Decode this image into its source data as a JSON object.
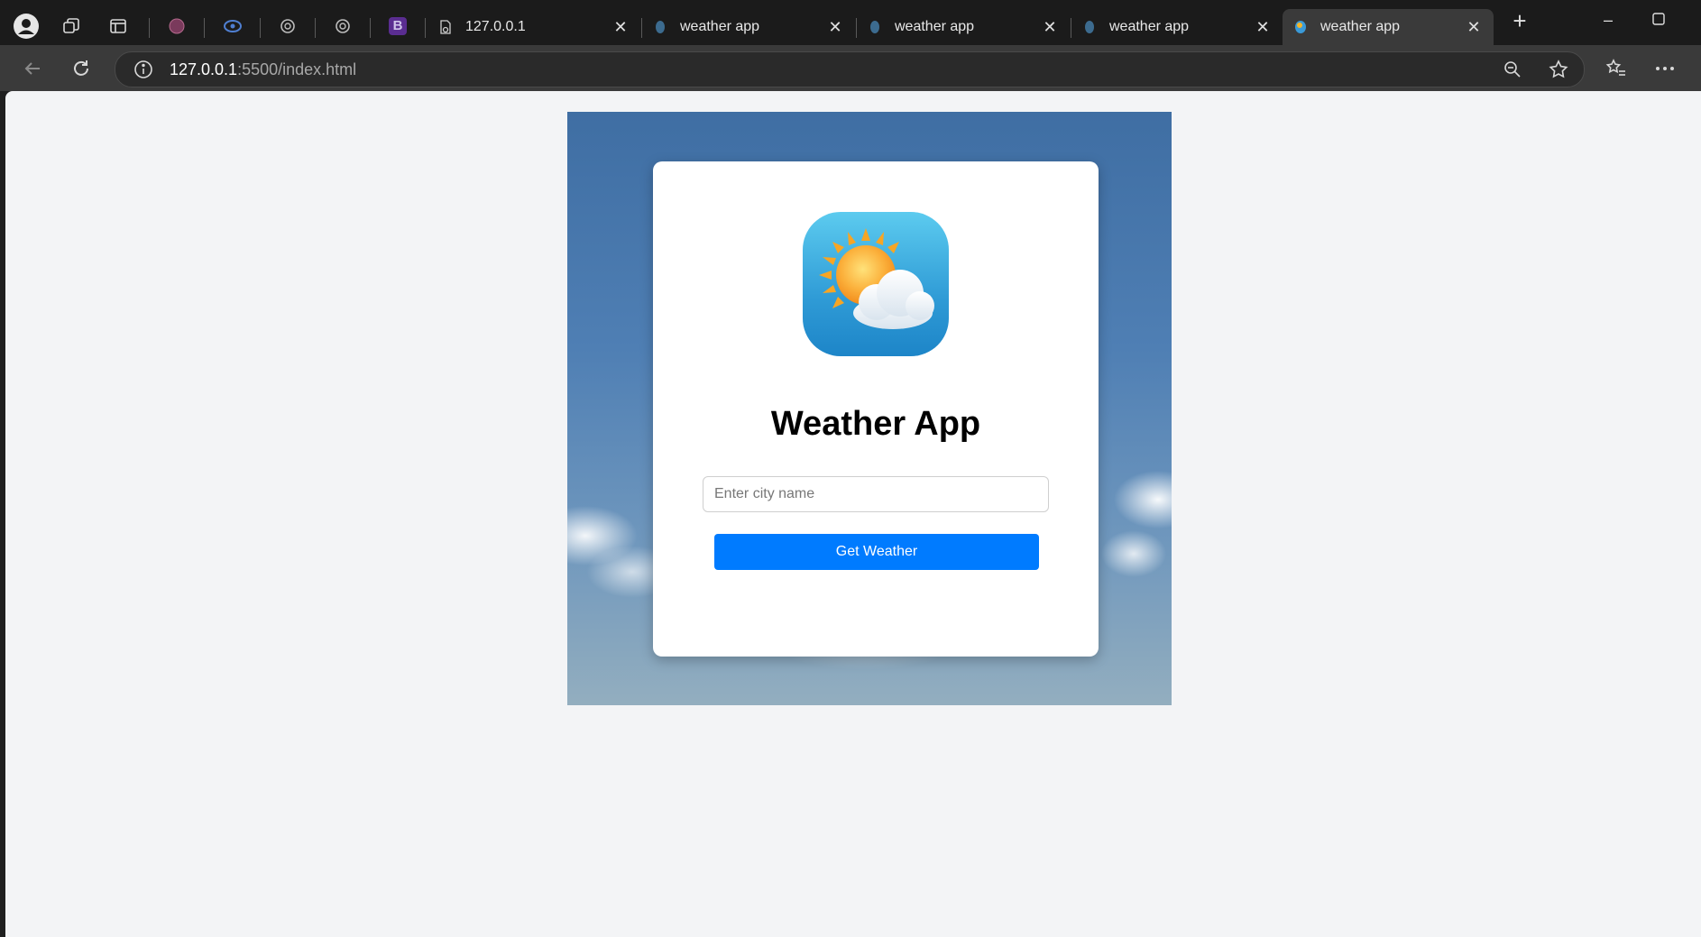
{
  "browser": {
    "tabs": [
      {
        "label": "127.0.0.1",
        "active": false
      },
      {
        "label": "weather app",
        "active": false
      },
      {
        "label": "weather app",
        "active": false
      },
      {
        "label": "weather app",
        "active": false
      },
      {
        "label": "weather app",
        "active": true
      }
    ],
    "pinned_icons": [
      "profile-icon",
      "workspaces-icon",
      "tab-actions-icon",
      "dribbble-icon",
      "copilot-icon",
      "chatgpt-icon",
      "chatgpt-icon",
      "bootstrap-icon"
    ],
    "bootstrap_letter": "B",
    "address": {
      "host": "127.0.0.1",
      "path": ":5500/index.html"
    }
  },
  "app": {
    "title": "Weather App",
    "city_placeholder": "Enter city name",
    "button_label": "Get Weather"
  },
  "colors": {
    "button": "#007bff",
    "page_bg": "#f3f4f6",
    "icon_bg": "#2f9bd6"
  }
}
